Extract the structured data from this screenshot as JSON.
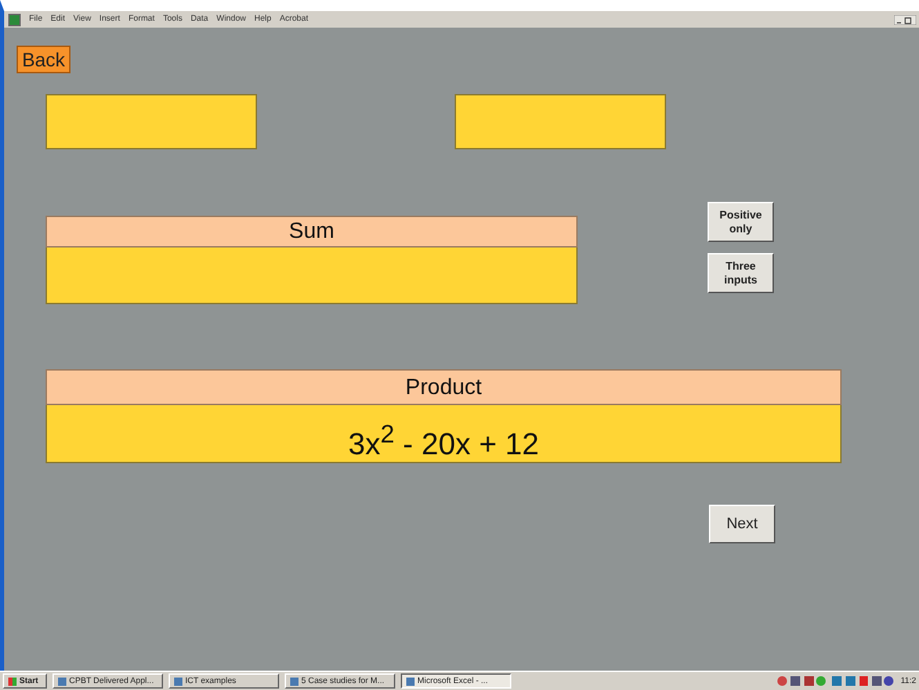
{
  "menu_bar": {
    "items": [
      "File",
      "Edit",
      "View",
      "Insert",
      "Format",
      "Tools",
      "Data",
      "Window",
      "Help",
      "Acrobat"
    ]
  },
  "back_button": "Back",
  "sum": {
    "label": "Sum"
  },
  "side_buttons": [
    "Positive\nonly",
    "Three\ninputs"
  ],
  "product": {
    "label": "Product",
    "value": "3x$^{2}$ - 20x + 12"
  },
  "next_button": "Next",
  "taskbar": {
    "start": "Start",
    "tasks": [
      {
        "label": "CPBT Delivered Appl...",
        "selected": false
      },
      {
        "label": "ICT examples",
        "selected": false
      },
      {
        "label": "5 Case studies for M...",
        "selected": false
      },
      {
        "label": "Microsoft Excel - ...",
        "selected": true
      }
    ],
    "clock": "11:2"
  }
}
